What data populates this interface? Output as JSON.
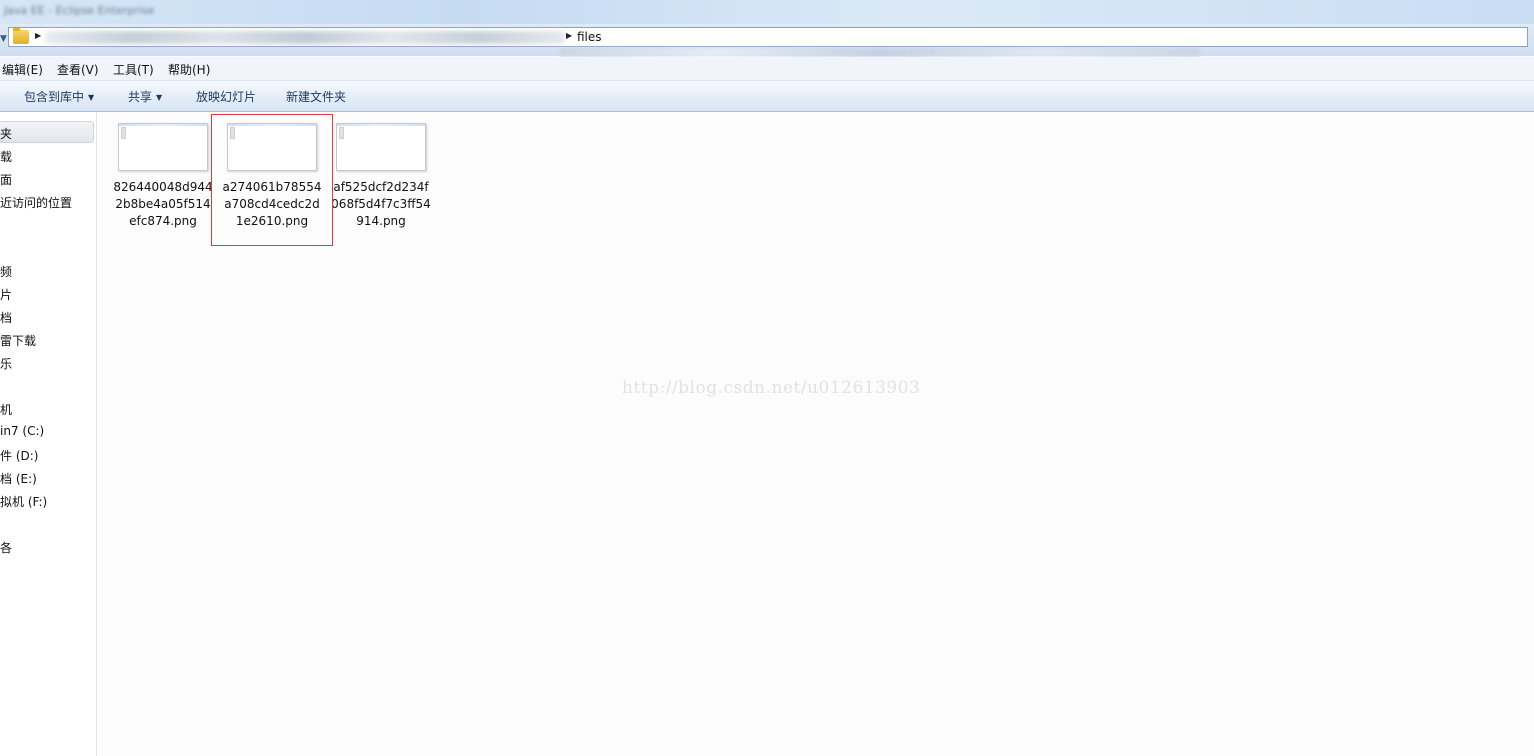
{
  "window": {
    "title": "Java EE - Eclipse Enterprise",
    "address": {
      "blurred_path": "",
      "current_folder": "files"
    }
  },
  "menu": {
    "items": [
      "编辑(E)",
      "查看(V)",
      "工具(T)",
      "帮助(H)"
    ]
  },
  "toolbar": {
    "include_library": "包含到库中",
    "share": "共享",
    "slideshow": "放映幻灯片",
    "new_folder": "新建文件夹"
  },
  "nav": {
    "items": [
      "夹",
      "载",
      "面",
      "近访问的位置",
      "频",
      "片",
      "档",
      "雷下载",
      "乐",
      "机",
      "in7 (C:)",
      "件 (D:)",
      "档 (E:)",
      "拟机 (F:)",
      "各"
    ]
  },
  "files": [
    {
      "name": "826440048d9442b8be4a05f514efc874.png"
    },
    {
      "name": "a274061b78554a708cd4cedc2d1e2610.png"
    },
    {
      "name": "af525dcf2d234f068f5d4f7c3ff54914.png"
    }
  ],
  "watermark": "http://blog.csdn.net/u012613903",
  "colors": {
    "highlight": "#e0393e",
    "toolbar_text": "#1e395b",
    "folder": "#f0c24b"
  }
}
